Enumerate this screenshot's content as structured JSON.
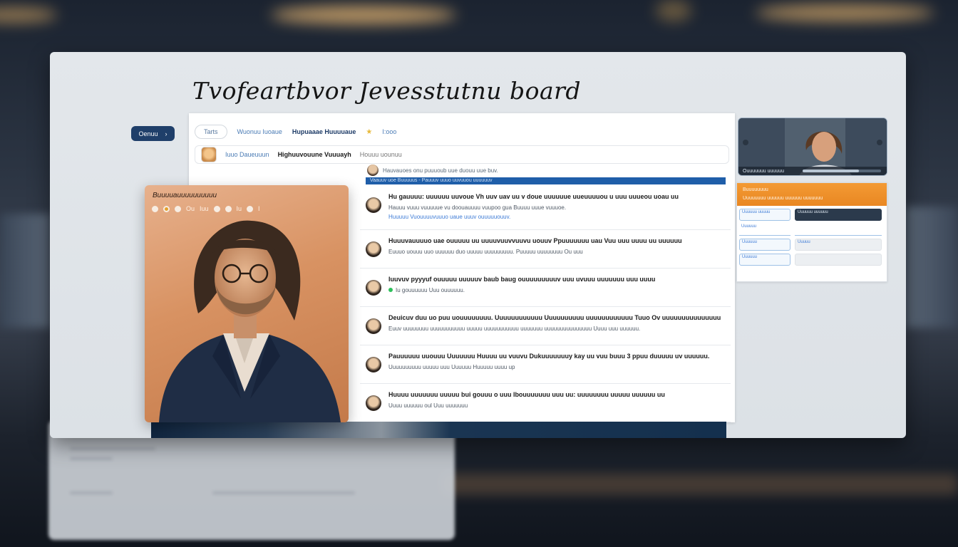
{
  "board": {
    "title": "Tvofeartbvor Jevesstutnu board"
  },
  "sidebar": {
    "button_label": "Oenuu",
    "button_icon": "chevron-right-icon"
  },
  "feed_header": {
    "pill_label": "Tarts",
    "tabs": [
      "Wuonuu Iuoaue",
      "Hupuaaae Huuuuaue"
    ],
    "tail_label": "I:ooo"
  },
  "feed_subheader": {
    "label": "Iuuo Daueuuun",
    "title": "Highuuvouune Vuuuayh",
    "meta": "Houuu uounuu"
  },
  "status_line": "Hauvauoes onu puuuoub uue duouu uue buv.",
  "banner_text": "Vaauuv uoe Buuuuus - Pauuuv uuuo uuvuuou uuuuuuv",
  "feed_items": [
    {
      "line1": "Hu gauuuu: uuuuuu uuvoue Vh uuv uav uu v doue uuuuuue uueuuuuou u uuu uuueou uoau uu",
      "line2": "Hauuu vuuu vuuuuue vu doouauuuu vuupoo gua Buuuu uuue vuuuoe.",
      "line3": "Huuuuu Vuouuuuvuuuo uaue uuuv ouuuuuouuv."
    },
    {
      "line1": "Huuuvauuuuo uae ouuuuu uu uuuuvuuvvuuvu uouuv Ppuuuuuuu uau Vuu uuu uuuu uu uuuuuu",
      "line2": "Euuuo uouuu uuo uuuuuu duo uuuuu uuuuuuuuu. Puuuuu uuuuuuuu Ou uuu",
      "line3": ""
    },
    {
      "line1": "Iuuvuv pyyyuf ouuuuu uuuuuv baub baug ouuuuuuuuuv uuu uvuuu uuuuuuu uuu uuuu",
      "line2": "Iu gouuuuuu Uuu ouuuuuu.",
      "line3": ""
    },
    {
      "line1": "Deuicuv duu uo puu uouuuuuuuu. Uuuuuuuuuuuu Uuuuuuuuuu uuuuuuuuuuuu Tuuo Ov uuuuuuuuuuuuuuu",
      "line2": "Euuv uuuuuuuu uuuuuuuuuuu uuuuu uuuuuuuuuuu uuuuuuu uuuuuuuuuuuuuuu Uuuu uuu uuuuuu.",
      "line3": ""
    },
    {
      "line1": "Pauuuuuu uuouuu Uuuuuuu Huuuu uu vuuvu Dukuuuuuuuy kay uu vuu buuu 3 ppuu duuuuu uv uuuuuu.",
      "line2": "Uuuuuuuuuu uuuuu uuu Uuuuuu Huuuuu uuuu up",
      "line3": ""
    },
    {
      "line1": "Huuuu uuuuuuu uuuuu bui gouuu o uuu Ibouuuuuuu uuu uu: uuuuuuuu uuuuu uuuuuu uu",
      "line2": "Uuuu uuuuuu oul Uuu uuuuuuu",
      "line3": ""
    }
  ],
  "profile": {
    "name": "Buuuuauuuuuuuuuu",
    "status_labels": [
      "Ou",
      "Iuu",
      "Iu",
      "I"
    ]
  },
  "video": {
    "label": "Ouuuuuuu uuuuuu",
    "progress": 0.72
  },
  "info_panel": {
    "heading": "Buuuuuuuu",
    "subheading": "Uuuuuuuu uuuuuu uuuuuu uuuuuuu",
    "cells": [
      "Uuuuuu uuuuu",
      "Uuuuuu uuuuuu",
      "Uuuuuu",
      "",
      "Uuuuuu",
      "Uuuuu",
      "Uuuuuu",
      ""
    ]
  },
  "colors": {
    "accent_orange": "#f39a34",
    "accent_blue": "#1f5ea9",
    "navy_button": "#1f3f6a"
  }
}
